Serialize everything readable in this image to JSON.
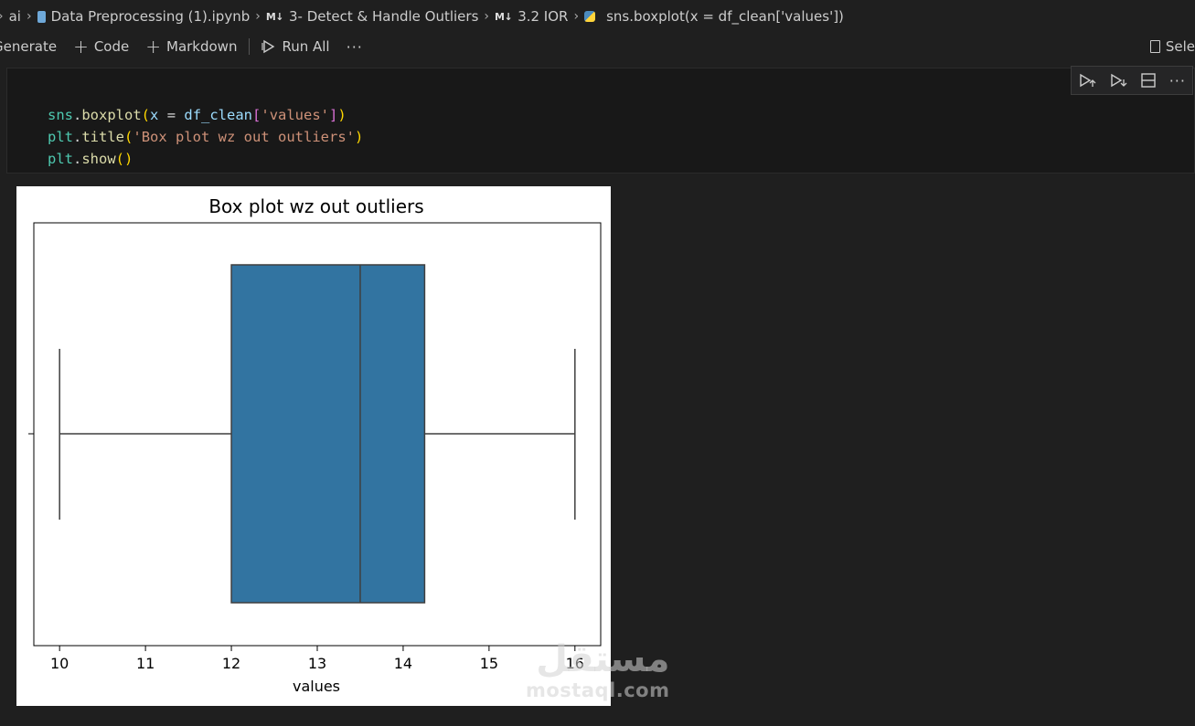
{
  "breadcrumb": {
    "root": "ai",
    "file": "Data Preprocessing (1).ipynb",
    "section_marker": "M↓",
    "section": "3- Detect & Handle Outliers",
    "subsection_marker": "M↓",
    "subsection": "3.2 IOR",
    "cell": "sns.boxplot(x = df_clean['values'])"
  },
  "toolbar": {
    "generate": "Generate",
    "code": "Code",
    "markdown": "Markdown",
    "run_all": "Run All",
    "more": "···",
    "select_kernel": "Sele"
  },
  "cell": {
    "code_lines": [
      "sns.boxplot(x = df_clean['values'])",
      "plt.title('Box plot wz out outliers')",
      "plt.show()"
    ]
  },
  "watermark": {
    "arabic": "مستقل",
    "latin": "mostaql.com"
  },
  "chart_data": {
    "type": "boxplot",
    "title": "Box plot wz out outliers",
    "xlabel": "values",
    "ylabel": "",
    "xlim": [
      9.7,
      16.3
    ],
    "xticks": [
      10,
      11,
      12,
      13,
      14,
      15,
      16
    ],
    "box": {
      "whisker_low": 10,
      "q1": 12,
      "median": 13.5,
      "q3": 14.25,
      "whisker_high": 16
    },
    "color": "#3274a1",
    "grid": false
  }
}
